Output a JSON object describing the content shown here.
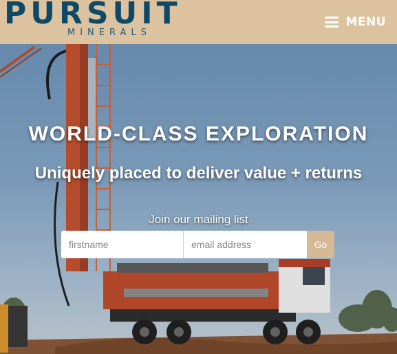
{
  "header": {
    "logo_word": "PURSUIT",
    "logo_sub": "MINERALS",
    "menu_label": "MENU",
    "colors": {
      "bar": "#dcc29f",
      "logo": "#0e4a68",
      "accent": "#d4b995"
    }
  },
  "hero": {
    "headline": "WORLD-CLASS EXPLORATION",
    "subheadline": "Uniquely placed to deliver value + returns",
    "mailing_label": "Join our mailing list",
    "form": {
      "firstname_placeholder": "firstname",
      "email_placeholder": "email address",
      "submit_label": "Go"
    }
  }
}
